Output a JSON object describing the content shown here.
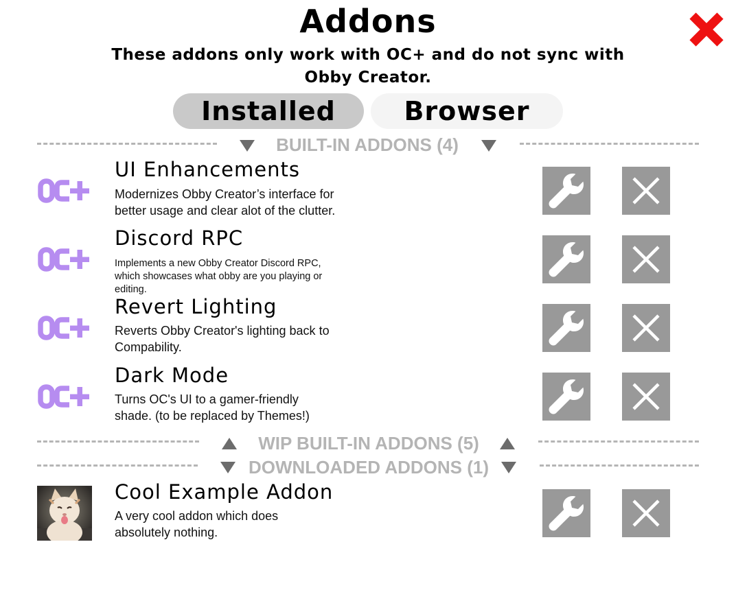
{
  "header": {
    "title": "Addons",
    "subtitle": "These addons only work with OC+ and do not sync with Obby Creator."
  },
  "tabs": [
    {
      "label": "Installed",
      "selected": true
    },
    {
      "label": "Browser",
      "selected": false
    }
  ],
  "sections": {
    "built_in": {
      "label": "BUILT-IN ADDONS (4)",
      "expanded": true
    },
    "wip": {
      "label": "WIP BUILT-IN ADDONS (5)",
      "expanded": false
    },
    "downloaded": {
      "label": "DOWNLOADED ADDONS (1)",
      "expanded": true
    }
  },
  "addons": [
    {
      "name": "UI Enhancements",
      "description": "Modernizes Obby Creator’s interface for better usage and clear alot of the clutter.",
      "icon": "oc-plus-logo"
    },
    {
      "name": "Discord RPC",
      "description": "Implements a new Obby Creator Discord RPC, which showcases what obby are you playing or editing.",
      "icon": "oc-plus-logo"
    },
    {
      "name": "Revert Lighting",
      "description": "Reverts Obby Creator's lighting back to Compability.",
      "icon": "oc-plus-logo"
    },
    {
      "name": "Dark Mode",
      "description": "Turns OC's UI to a gamer-friendly shade. (to be replaced by Themes!)",
      "icon": "oc-plus-logo"
    }
  ],
  "downloaded_addons": [
    {
      "name": "Cool Example Addon",
      "description": "A very cool addon which does absolutely nothing.",
      "icon": "cat-thumbnail"
    }
  ],
  "icons": {
    "close": "close-icon",
    "settings": "wrench-icon",
    "remove": "x-icon"
  },
  "colors": {
    "accent_purple": "#b68cf0",
    "close_red": "#ee1111",
    "button_gray": "#999999",
    "tab_selected": "#c9c9c9",
    "tab_unselected": "#f4f4f4",
    "section_text": "#b4b4b4"
  }
}
